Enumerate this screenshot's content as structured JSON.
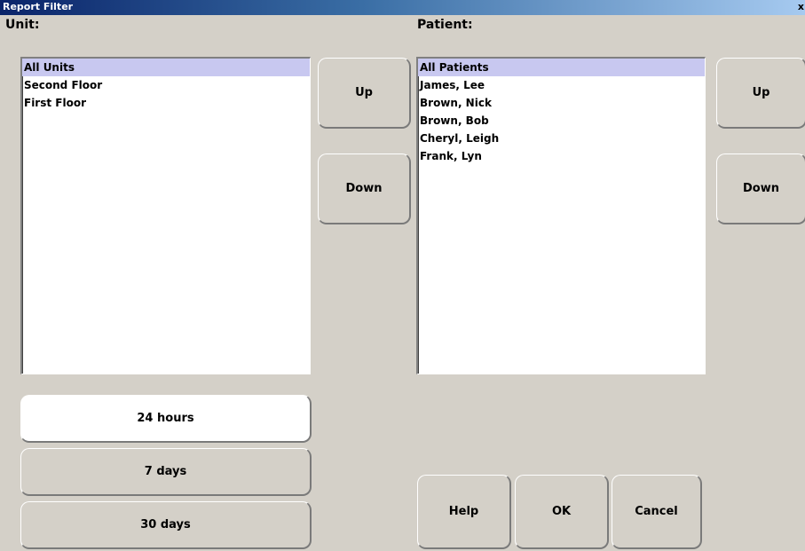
{
  "window": {
    "title": "Report Filter",
    "close_glyph": "x"
  },
  "unit": {
    "label": "Unit:",
    "items": [
      "All Units",
      "Second Floor",
      "First Floor"
    ],
    "selected_index": 0,
    "up_label": "Up",
    "down_label": "Down"
  },
  "patient": {
    "label": "Patient:",
    "items": [
      "All Patients",
      "James, Lee",
      "Brown, Nick",
      "Brown, Bob",
      "Cheryl, Leigh",
      "Frank, Lyn"
    ],
    "selected_index": 0,
    "up_label": "Up",
    "down_label": "Down"
  },
  "time_range": {
    "options": [
      "24 hours",
      "7 days",
      "30 days"
    ],
    "selected": "24 hours"
  },
  "actions": {
    "help": "Help",
    "ok": "OK",
    "cancel": "Cancel"
  },
  "colors": {
    "window_bg": "#d4d0c8",
    "selection": "#c8c8f0",
    "titlebar_start": "#0a246a",
    "titlebar_end": "#a6caf0"
  }
}
